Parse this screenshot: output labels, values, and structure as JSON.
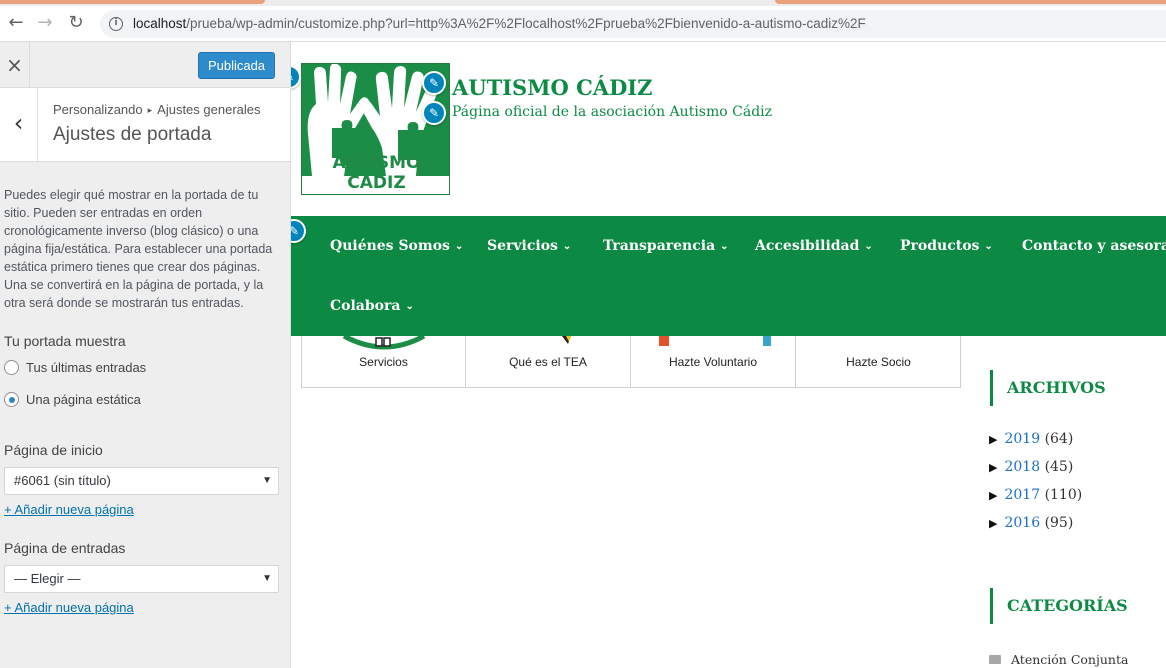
{
  "browser": {
    "url_host": "localhost",
    "url_rest": "/prueba/wp-admin/customize.php?url=http%3A%2F%2Flocalhost%2Fprueba%2Fbienvenido-a-autismo-cadiz%2F"
  },
  "sidebar": {
    "close_icon": "×",
    "publish_label": "Publicada",
    "back_icon": "‹",
    "breadcrumb_parent": "Personalizando",
    "breadcrumb_sep": "▸",
    "breadcrumb_current": "Ajustes generales",
    "section_title": "Ajustes de portada",
    "description": "Puedes elegir qué mostrar en la portada de tu sitio. Pueden ser entradas en orden cronológicamente inverso (blog clásico) o una página fija/estática. Para establecer una portada estática primero tienes que crear dos páginas. Una se convertirá en la página de portada, y la otra será donde se mostrarán tus entradas.",
    "front_label": "Tu portada muestra",
    "radio_latest": "Tus últimas entradas",
    "radio_static": "Una página estática",
    "homepage_label": "Página de inicio",
    "homepage_value": "#6061 (sin título)",
    "add_page_1": "+ Añadir nueva página",
    "posts_label": "Página de entradas",
    "posts_value": "— Elegir —",
    "add_page_2": "+ Añadir nueva página"
  },
  "site": {
    "logo_text": "AUTISMO CÁDIZ",
    "title": "AUTISMO CÁDIZ",
    "tagline": "Página oficial de la asociación Autismo Cádiz",
    "pencil_icon": "✎"
  },
  "nav": {
    "items": [
      "Quiénes Somos",
      "Servicios",
      "Transparencia",
      "Accesibilidad",
      "Productos",
      "Contacto y asesorami",
      "Colabora"
    ],
    "chevron": "⌄"
  },
  "boxes": [
    "Servicios",
    "Qué es el TEA",
    "Hazte Voluntario",
    "Hazte Socio"
  ],
  "archives": {
    "title": "ARCHIVOS",
    "items": [
      {
        "year": "2019",
        "count": "(64)"
      },
      {
        "year": "2018",
        "count": "(45)"
      },
      {
        "year": "2017",
        "count": "(110)"
      },
      {
        "year": "2016",
        "count": "(95)"
      }
    ],
    "triangle": "▶"
  },
  "categories": {
    "title": "CATEGORÍAS",
    "first": "Atención Conjunta"
  },
  "colors": {
    "brand_green": "#0c8a43",
    "publish_blue": "#2e8bcc",
    "link_blue": "#0073aa"
  }
}
